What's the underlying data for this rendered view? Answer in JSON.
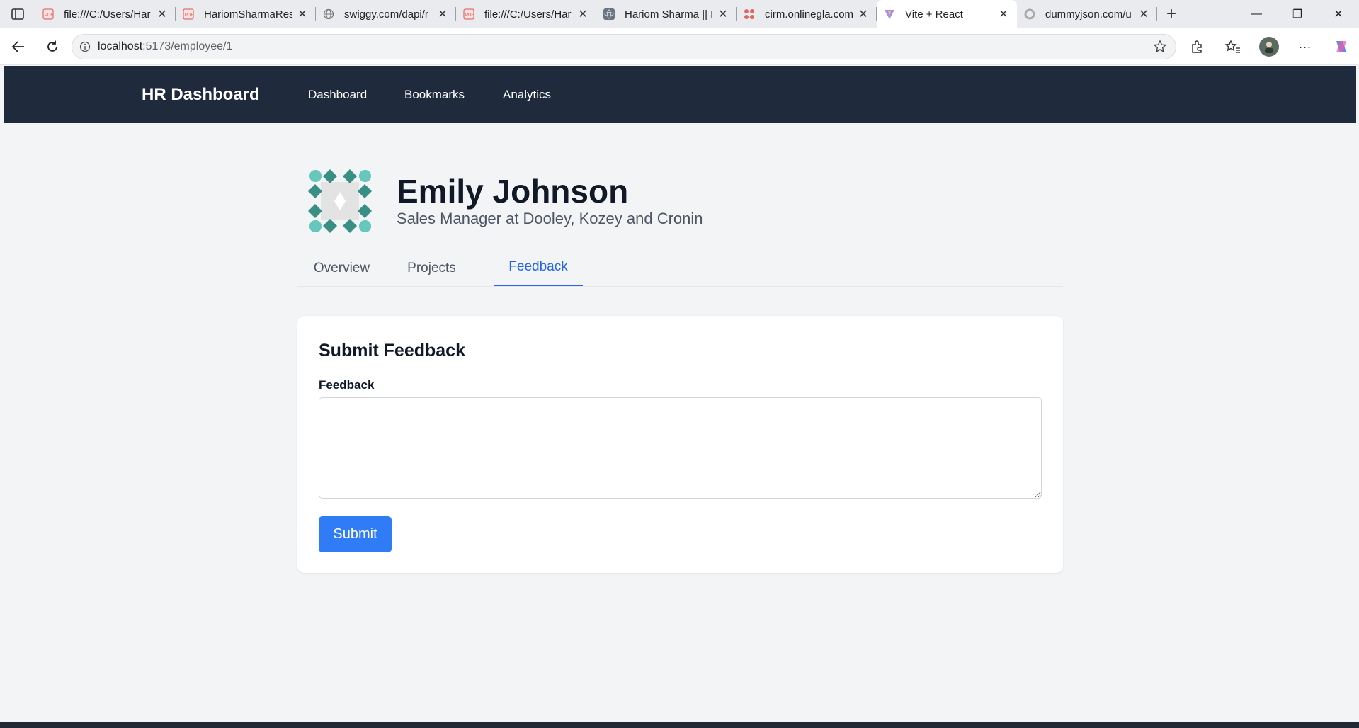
{
  "browser": {
    "tabs": [
      {
        "title": "file:///C:/Users/Har",
        "icon": "pdf-icon",
        "active": false
      },
      {
        "title": "HariomSharmaRes",
        "icon": "pdf-icon",
        "active": false
      },
      {
        "title": "swiggy.com/dapi/r",
        "icon": "globe-icon",
        "active": false
      },
      {
        "title": "file:///C:/Users/Har",
        "icon": "pdf-icon",
        "active": false
      },
      {
        "title": "Hariom Sharma || I",
        "icon": "react-icon",
        "active": false
      },
      {
        "title": "cirm.onlinegla.com",
        "icon": "cirm-icon",
        "active": false
      },
      {
        "title": "Vite + React",
        "icon": "vite-icon",
        "active": true
      },
      {
        "title": "dummyjson.com/u",
        "icon": "loading-icon",
        "active": false
      }
    ],
    "url_host": "localhost",
    "url_rest": ":5173/employee/1"
  },
  "navbar": {
    "brand": "HR Dashboard",
    "links": [
      "Dashboard",
      "Bookmarks",
      "Analytics"
    ]
  },
  "profile": {
    "name": "Emily Johnson",
    "role": "Sales Manager at Dooley, Kozey and Cronin",
    "avatar_icon": "identicon-avatar"
  },
  "tabs": {
    "items": [
      "Overview",
      "Projects",
      "Feedback"
    ],
    "active": "Feedback"
  },
  "feedback_form": {
    "title": "Submit Feedback",
    "label": "Feedback",
    "value": "",
    "submit_label": "Submit"
  },
  "colors": {
    "navbar_bg": "#1f2a3c",
    "accent": "#2563eb",
    "button": "#2f7cf6",
    "page_bg": "#f3f4f6"
  }
}
